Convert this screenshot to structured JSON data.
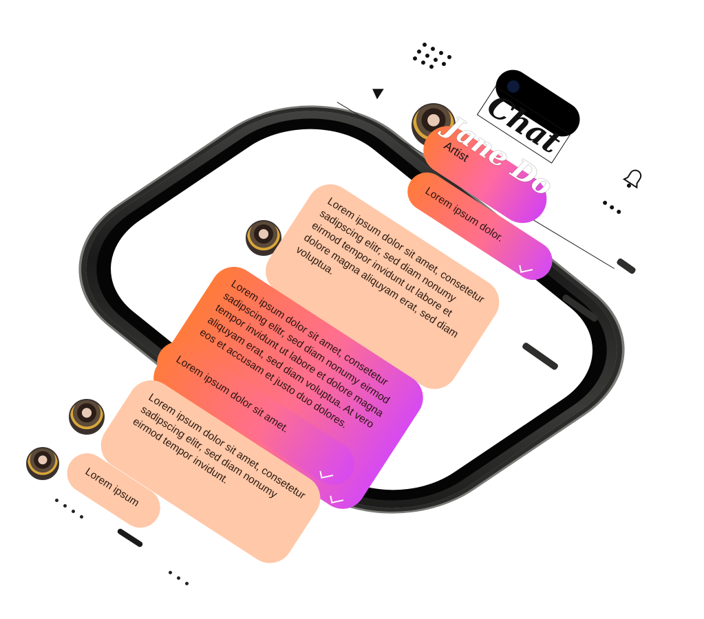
{
  "app": {
    "title": "Chat",
    "contact_name": "Jane Do",
    "contact_role": "Artist"
  },
  "icons": {
    "menu": "dot-grid-icon",
    "back": "back-arrow-icon",
    "notifications": "bell-icon",
    "more": "more-dots-icon"
  },
  "colors": {
    "outgoing_start": "#ff7b3a",
    "outgoing_end": "#d64af2",
    "incoming": "#ffc8a8",
    "frame": "#1b1b1b"
  },
  "messages": [
    {
      "direction": "out",
      "text": "Lorem ipsum dolor.",
      "read": true
    },
    {
      "direction": "in",
      "text": "Lorem ipsum dolor sit amet, consetetur sadipscing elitr, sed diam nonumy eirmod tempor invidunt ut labore et dolore magna aliquyam erat, sed diam voluptua."
    },
    {
      "direction": "out",
      "text": "Lorem ipsum dolor sit amet, consetetur sadipscing elitr, sed diam nonumy eirmod tempor invidunt ut labore et dolore magna aliquyam erat, sed diam voluptua. At vero eos et accusam et justo duo dolores.",
      "read": true
    },
    {
      "direction": "out",
      "text": "Lorem ipsum dolor sit amet.",
      "read": true
    },
    {
      "direction": "in",
      "text": "Lorem ipsum dolor sit amet, consetetur sadipscing elitr, sed diam nonumy eirmod tempor invidunt."
    },
    {
      "direction": "in",
      "text": "Lorem ipsum"
    }
  ]
}
